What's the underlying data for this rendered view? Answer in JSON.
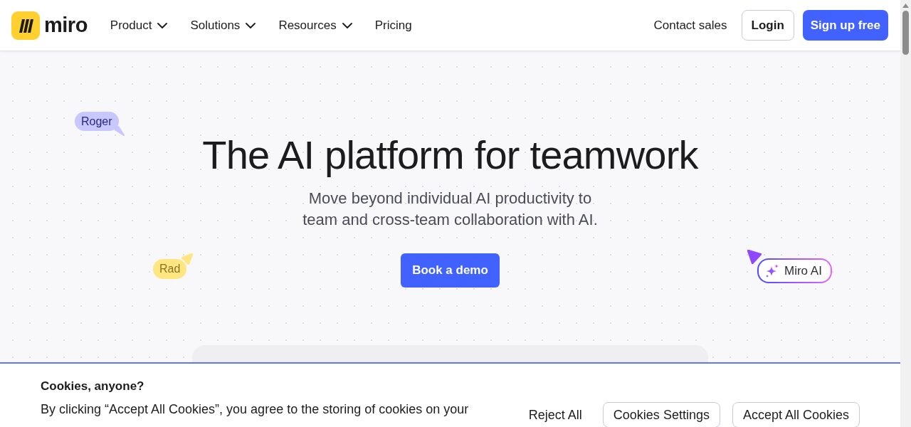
{
  "nav": {
    "logo": {
      "wordmark": "miro"
    },
    "menu": [
      {
        "label": "Product",
        "dropdown": true
      },
      {
        "label": "Solutions",
        "dropdown": true
      },
      {
        "label": "Resources",
        "dropdown": true
      },
      {
        "label": "Pricing",
        "dropdown": false
      }
    ],
    "contact": "Contact sales",
    "login": "Login",
    "signup": "Sign up free"
  },
  "hero": {
    "title": "The AI platform for teamwork",
    "subtitle": "Move beyond individual AI productivity to team and cross-team collaboration with AI.",
    "cta": "Book a demo"
  },
  "cursors": [
    {
      "name": "Roger",
      "kind": "user",
      "color": "#c8c7ff"
    },
    {
      "name": "Rad",
      "kind": "user",
      "color": "#ffe680"
    },
    {
      "name": "Miro AI",
      "kind": "ai",
      "color": "#8f48ff"
    }
  ],
  "cookie_banner": {
    "title": "Cookies, anyone?",
    "text": "By clicking “Accept All Cookies”, you agree to the storing of cookies on your",
    "buttons": [
      {
        "label": "Reject All",
        "kind": "link"
      },
      {
        "label": "Cookies Settings",
        "kind": "outline"
      },
      {
        "label": "Accept All Cookies",
        "kind": "outline"
      }
    ]
  }
}
